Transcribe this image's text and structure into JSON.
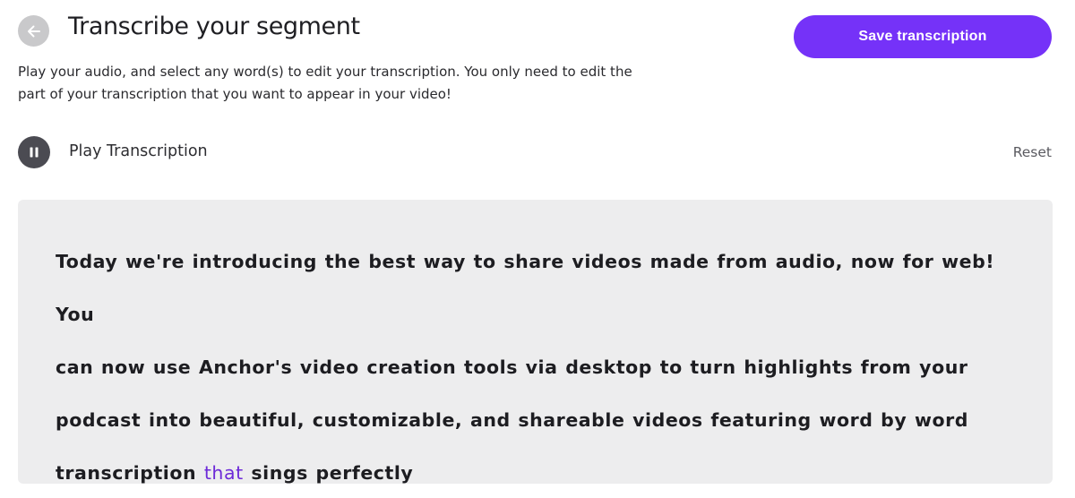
{
  "header": {
    "title": "Transcribe your segment",
    "save_label": "Save transcription"
  },
  "instructions": {
    "line1": "Play your audio, and select any word(s) to edit your transcription. You only need to edit the",
    "line2": "part of your transcription that you want to appear in your video!"
  },
  "player": {
    "play_label": "Play Transcription",
    "reset_label": "Reset",
    "state": "playing"
  },
  "transcript": {
    "lines": [
      [
        "Today",
        "we're",
        "introducing",
        "the",
        "best",
        "way",
        "to",
        "share",
        "videos",
        "made",
        "from",
        "audio,",
        "now",
        "for",
        "web!",
        "You"
      ],
      [
        "can",
        "now",
        "use",
        "Anchor's",
        "video",
        "creation",
        "tools",
        "via",
        "desktop",
        "to",
        "turn",
        "highlights",
        "from",
        "your"
      ],
      [
        "podcast",
        "into",
        "beautiful,",
        "customizable,",
        "and",
        "shareable",
        "videos",
        "featuring",
        "word",
        "by",
        "word"
      ],
      [
        "transcription",
        "that",
        "sings",
        "perfectly"
      ]
    ],
    "highlighted_word": "that",
    "highlight_color": "#6d2ad8"
  },
  "colors": {
    "accent": "#7532f8",
    "panel_background": "#ededee",
    "back_button": "#c9c9cb",
    "play_button": "#4b4b52"
  },
  "icons": {
    "back": "arrow-left-icon",
    "play_state": "pause-icon"
  }
}
